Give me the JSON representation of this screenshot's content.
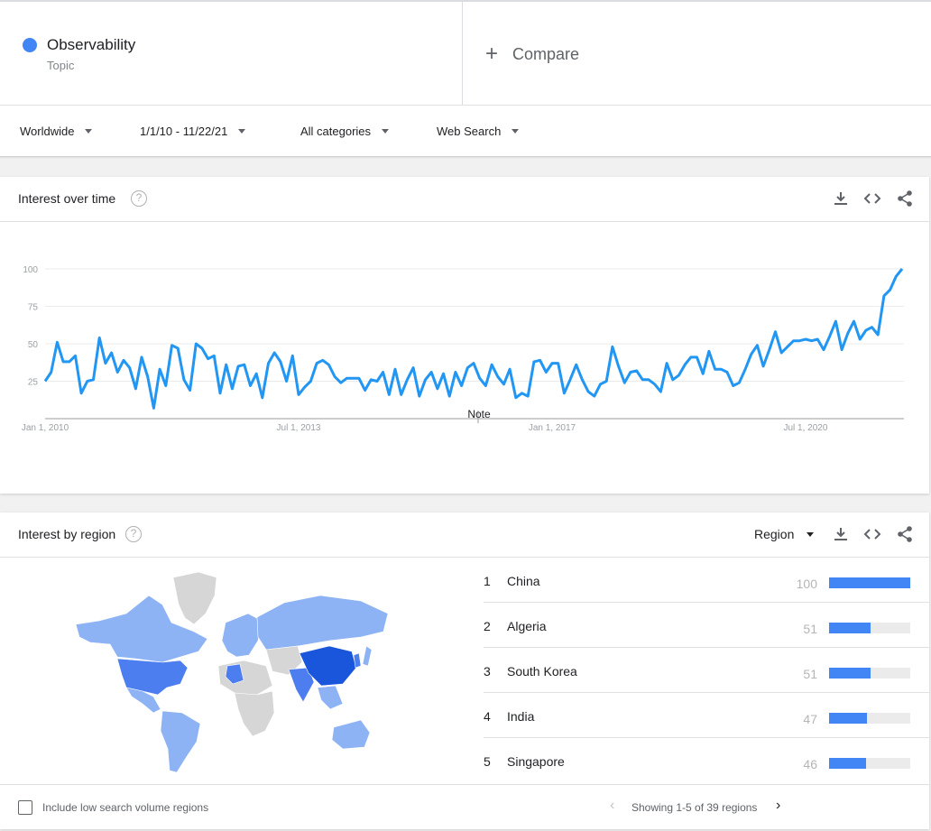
{
  "term": {
    "name": "Observability",
    "type": "Topic",
    "color": "#4285f4"
  },
  "compare": {
    "icon": "plus-icon",
    "label": "Compare"
  },
  "filters": {
    "location": "Worldwide",
    "date_range": "1/1/10 - 11/22/21",
    "category": "All categories",
    "property": "Web Search"
  },
  "interest_over_time": {
    "title": "Interest over time",
    "help_icon": "question-icon",
    "actions": [
      "download-icon",
      "embed-icon",
      "share-icon"
    ],
    "note_label": "Note",
    "chart_data": {
      "type": "line",
      "xlabel": "",
      "ylabel": "",
      "ylim": [
        0,
        100
      ],
      "y_ticks": [
        25,
        50,
        75,
        100
      ],
      "x_ticks": [
        "Jan 1, 2010",
        "Jul 1, 2013",
        "Jan 1, 2017",
        "Jul 1, 2020"
      ],
      "grid": true,
      "color": "#2196f3",
      "series": [
        {
          "x_start": "2010-01",
          "x_step": "month",
          "values": [
            25,
            31,
            51,
            38,
            38,
            42,
            17,
            25,
            26,
            54,
            37,
            44,
            31,
            39,
            34,
            20,
            41,
            28,
            7,
            33,
            22,
            49,
            47,
            26,
            19,
            50,
            47,
            40,
            42,
            17,
            36,
            20,
            35,
            36,
            22,
            30,
            14,
            37,
            44,
            38,
            25,
            42,
            16,
            21,
            25,
            37,
            39,
            36,
            28,
            24,
            27,
            27,
            27,
            19,
            26,
            25,
            31,
            16,
            33,
            16,
            26,
            34,
            15,
            26,
            31,
            20,
            30,
            15,
            31,
            22,
            34,
            37,
            27,
            22,
            36,
            28,
            23,
            33,
            14,
            17,
            15,
            38,
            39,
            31,
            37,
            37,
            17,
            26,
            36,
            26,
            18,
            15,
            23,
            25,
            48,
            35,
            24,
            31,
            32,
            26,
            26,
            23,
            18,
            37,
            26,
            29,
            36,
            41,
            41,
            30,
            45,
            33,
            33,
            31,
            22,
            24,
            33,
            43,
            49,
            35,
            46,
            58,
            44,
            48,
            52,
            52,
            53,
            52,
            53,
            46,
            55,
            65,
            46,
            57,
            65,
            53,
            59,
            61,
            56,
            82,
            86,
            95,
            100
          ]
        }
      ]
    }
  },
  "interest_by_region": {
    "title": "Interest by region",
    "help_icon": "question-icon",
    "resolution_label": "Region",
    "actions": [
      "download-icon",
      "embed-icon",
      "share-icon"
    ],
    "regions": [
      {
        "rank": "1",
        "name": "China",
        "value": 100
      },
      {
        "rank": "2",
        "name": "Algeria",
        "value": 51
      },
      {
        "rank": "3",
        "name": "South Korea",
        "value": 51
      },
      {
        "rank": "4",
        "name": "India",
        "value": 47
      },
      {
        "rank": "5",
        "name": "Singapore",
        "value": 46
      }
    ],
    "include_low_volume_label": "Include low search volume regions",
    "pagination_text": "Showing 1-5 of 39 regions",
    "map_colors": {
      "high": "#1a56db",
      "mid": "#4d7ef0",
      "low": "#8db3f5",
      "none": "#d6d6d6"
    }
  }
}
